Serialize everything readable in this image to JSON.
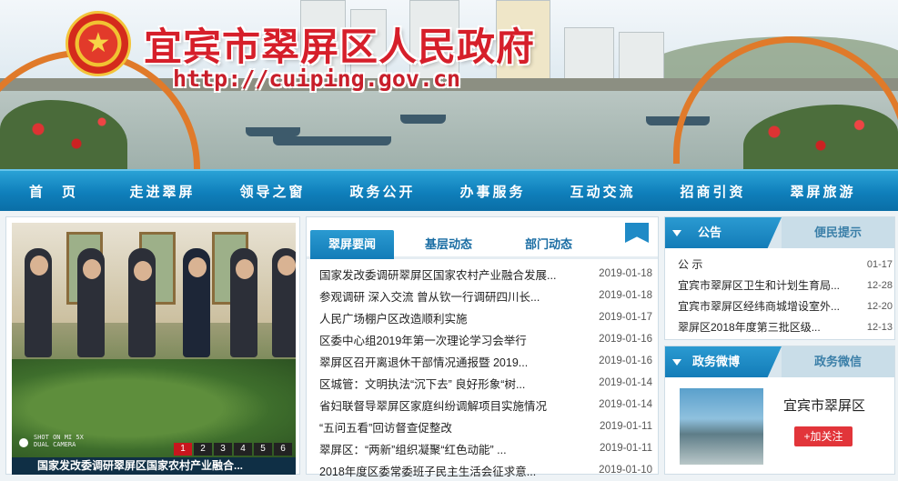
{
  "header": {
    "site_title": "宜宾市翠屏区人民政府",
    "site_url": "http://cuiping.gov.cn",
    "emblem_icon": "national-emblem-icon",
    "accent_red": "#d61f2a"
  },
  "nav": {
    "items": [
      "首　页",
      "走进翠屏",
      "领导之窗",
      "政务公开",
      "办事服务",
      "互动交流",
      "招商引资",
      "翠屏旅游"
    ],
    "bg_color": "#137cb8"
  },
  "slideshow": {
    "caption": "国家发改委调研翠屏区国家农村产业融合...",
    "pages": [
      "1",
      "2",
      "3",
      "4",
      "5",
      "6"
    ],
    "active_page": "1",
    "watermark": "SHOT ON MI 5X\nDUAL CAMERA"
  },
  "news": {
    "tabs": [
      "翠屏要闻",
      "基层动态",
      "部门动态"
    ],
    "active_tab": "翠屏要闻",
    "items": [
      {
        "title": "国家发改委调研翠屏区国家农村产业融合发展...",
        "date": "2019-01-18"
      },
      {
        "title": "参观调研 深入交流 曾从钦一行调研四川长...",
        "date": "2019-01-18"
      },
      {
        "title": "人民广场棚户区改造顺利实施",
        "date": "2019-01-17"
      },
      {
        "title": "区委中心组2019年第一次理论学习会举行",
        "date": "2019-01-16"
      },
      {
        "title": "翠屏区召开离退休干部情况通报暨 2019...",
        "date": "2019-01-16"
      },
      {
        "title": "区城管：文明执法“沉下去” 良好形象“树...",
        "date": "2019-01-14"
      },
      {
        "title": "省妇联督导翠屏区家庭纠纷调解项目实施情况",
        "date": "2019-01-14"
      },
      {
        "title": "“五问五看”回访督查促整改",
        "date": "2019-01-11"
      },
      {
        "title": "翠屏区：“两新”组织凝聚“红色动能” ...",
        "date": "2019-01-11"
      },
      {
        "title": "2018年度区委常委班子民主生活会征求意...",
        "date": "2019-01-10"
      }
    ]
  },
  "notice": {
    "tabs": [
      "公告",
      "便民提示"
    ],
    "active_tab": "公告",
    "items": [
      {
        "title": "公 示",
        "date": "01-17"
      },
      {
        "title": "宜宾市翠屏区卫生和计划生育局...",
        "date": "12-28"
      },
      {
        "title": "宜宾市翠屏区经纬商城增设室外...",
        "date": "12-20"
      },
      {
        "title": "翠屏区2018年度第三批区级...",
        "date": "12-13"
      }
    ]
  },
  "weibo": {
    "tabs": [
      "政务微博",
      "政务微信"
    ],
    "active_tab": "政务微博",
    "account_name": "宜宾市翠屏区",
    "follow_label": "+加关注"
  }
}
